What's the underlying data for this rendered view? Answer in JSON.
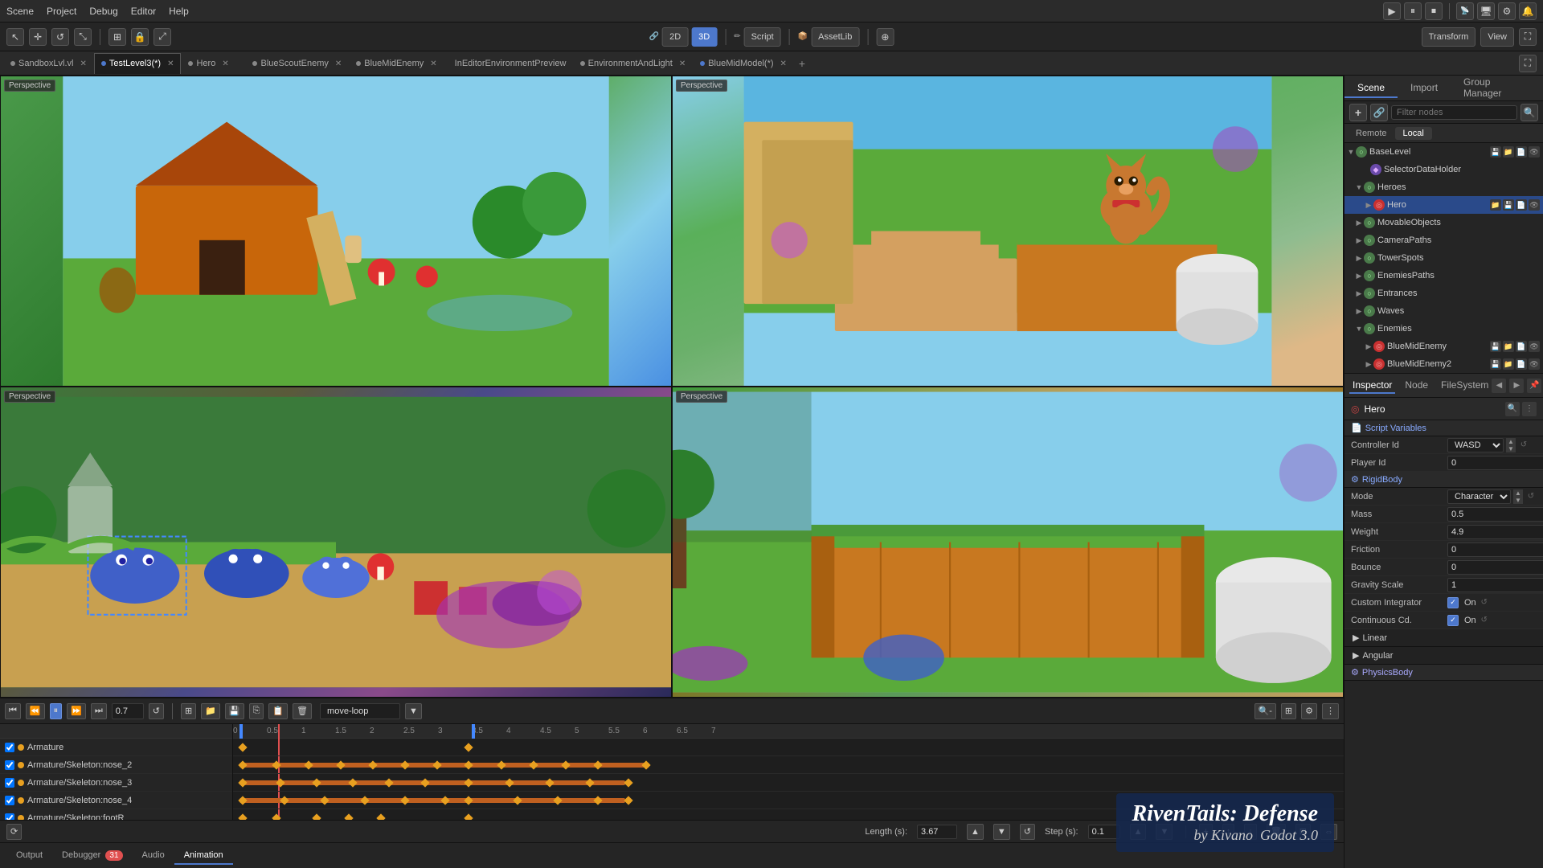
{
  "menubar": {
    "items": [
      "Scene",
      "Project",
      "Debug",
      "Editor",
      "Help"
    ]
  },
  "toolbar": {
    "mode_2d": "2D",
    "mode_3d": "3D",
    "mode_script": "Script",
    "mode_assetlib": "AssetLib",
    "transform_label": "Transform",
    "view_label": "View"
  },
  "tabs": [
    {
      "id": "sandbox",
      "label": "SandboxLvl.vl",
      "modified": false,
      "icon": "⊙"
    },
    {
      "id": "testlevel3",
      "label": "TestLevel3(*)",
      "modified": true,
      "icon": "⊙"
    },
    {
      "id": "hero",
      "label": "Hero",
      "modified": false,
      "icon": "⊙"
    },
    {
      "id": "blueScout",
      "label": "BlueScoutEnemy",
      "modified": false,
      "icon": "⊙"
    },
    {
      "id": "blueMid",
      "label": "BlueMidEnemy",
      "modified": false,
      "icon": "⊙"
    },
    {
      "id": "inEditor",
      "label": "InEditorEnvironmentPreview",
      "modified": false,
      "icon": "⊙"
    },
    {
      "id": "envLight",
      "label": "EnvironmentAndLight",
      "modified": false,
      "icon": "⊙"
    },
    {
      "id": "blueMidModel",
      "label": "BlueMidModel(*)",
      "modified": true,
      "icon": "⊙"
    }
  ],
  "scene_panel": {
    "title": "Scene",
    "import_tab": "Import",
    "group_manager_tab": "Group Manager",
    "filter_placeholder": "Filter nodes",
    "remote_label": "Remote",
    "local_label": "Local",
    "tree": [
      {
        "id": "baseLevel",
        "label": "BaseLevel",
        "level": 0,
        "type": "spatial",
        "expanded": true,
        "icons": [
          "save",
          "load",
          "script",
          "eye"
        ]
      },
      {
        "id": "selectorDataHolder",
        "label": "SelectorDataHolder",
        "level": 1,
        "type": "mesh",
        "expanded": false,
        "icons": []
      },
      {
        "id": "heroes",
        "label": "Heroes",
        "level": 1,
        "type": "spatial",
        "expanded": true,
        "icons": []
      },
      {
        "id": "hero",
        "label": "Hero",
        "level": 2,
        "type": "kinematic",
        "expanded": false,
        "selected": true,
        "icons": [
          "load",
          "save",
          "script",
          "eye"
        ]
      },
      {
        "id": "movableObjects",
        "label": "MovableObjects",
        "level": 1,
        "type": "spatial",
        "expanded": false,
        "icons": []
      },
      {
        "id": "cameraPaths",
        "label": "CameraPaths",
        "level": 1,
        "type": "spatial",
        "expanded": false,
        "icons": []
      },
      {
        "id": "towerSpots",
        "label": "TowerSpots",
        "level": 1,
        "type": "spatial",
        "expanded": false,
        "icons": []
      },
      {
        "id": "enemiesPaths",
        "label": "EnemiesPaths",
        "level": 1,
        "type": "spatial",
        "expanded": false,
        "icons": []
      },
      {
        "id": "entrances",
        "label": "Entrances",
        "level": 1,
        "type": "spatial",
        "expanded": false,
        "icons": []
      },
      {
        "id": "waves",
        "label": "Waves",
        "level": 1,
        "type": "spatial",
        "expanded": false,
        "icons": []
      },
      {
        "id": "enemies",
        "label": "Enemies",
        "level": 1,
        "type": "spatial",
        "expanded": true,
        "icons": []
      },
      {
        "id": "blueMidEnemy",
        "label": "BlueMidEnemy",
        "level": 2,
        "type": "kinematic",
        "expanded": false,
        "icons": [
          "save",
          "load",
          "script",
          "eye"
        ]
      },
      {
        "id": "blueMidEnemy2",
        "label": "BlueMidEnemy2",
        "level": 2,
        "type": "kinematic",
        "expanded": false,
        "icons": [
          "save",
          "load",
          "script",
          "eye"
        ]
      }
    ]
  },
  "inspector": {
    "title": "Inspector",
    "node_tab": "Inspector",
    "node_tab2": "Node",
    "filesystem_tab": "FileSystem",
    "node_name": "Hero",
    "script_variables_section": "Script Variables",
    "rigidbody_section": "RigidBody",
    "physicsbody_section": "PhysicsBody",
    "fields": [
      {
        "label": "Controller Id",
        "value": "WASD",
        "type": "dropdown"
      },
      {
        "label": "Player Id",
        "value": "0",
        "type": "number"
      },
      {
        "label": "Mode",
        "value": "Character",
        "type": "dropdown"
      },
      {
        "label": "Mass",
        "value": "0.5",
        "type": "number"
      },
      {
        "label": "Weight",
        "value": "4.9",
        "type": "number"
      },
      {
        "label": "Friction",
        "value": "0",
        "type": "number"
      },
      {
        "label": "Bounce",
        "value": "0",
        "type": "number"
      },
      {
        "label": "Gravity Scale",
        "value": "1",
        "type": "number"
      },
      {
        "label": "Custom Integrator",
        "value": "On",
        "type": "checkbox"
      },
      {
        "label": "Continuous Cd.",
        "value": "On",
        "type": "checkbox"
      }
    ],
    "linear_label": "Linear",
    "angular_label": "Angular"
  },
  "timeline": {
    "animation_name": "move-loop",
    "time_value": "0.7",
    "length_label": "Length (s):",
    "length_value": "3.67",
    "step_label": "Step (s):",
    "step_value": "0.1",
    "ruler_marks": [
      "0",
      "0.5",
      "1",
      "1.5",
      "2",
      "2.5",
      "3",
      "3.5",
      "4",
      "4.5",
      "5",
      "5.5",
      "6",
      "6.5",
      "7"
    ],
    "tracks": [
      {
        "label": "Armature",
        "color": "#e8a020"
      },
      {
        "label": "Armature/Skeleton:nose_2",
        "color": "#e8a020"
      },
      {
        "label": "Armature/Skeleton:nose_3",
        "color": "#e8a020"
      },
      {
        "label": "Armature/Skeleton:nose_4",
        "color": "#e8a020"
      },
      {
        "label": "Armature/Skeleton:footR",
        "color": "#e8a020"
      }
    ]
  },
  "bottom_tabs": [
    {
      "label": "Output",
      "active": false
    },
    {
      "label": "Debugger",
      "badge": "31",
      "active": false
    },
    {
      "label": "Audio",
      "active": false
    },
    {
      "label": "Animation",
      "active": true
    }
  ],
  "watermark": {
    "title": "RivenTails: Defense",
    "by": "by Kivano",
    "engine": "Godot 3.0"
  }
}
